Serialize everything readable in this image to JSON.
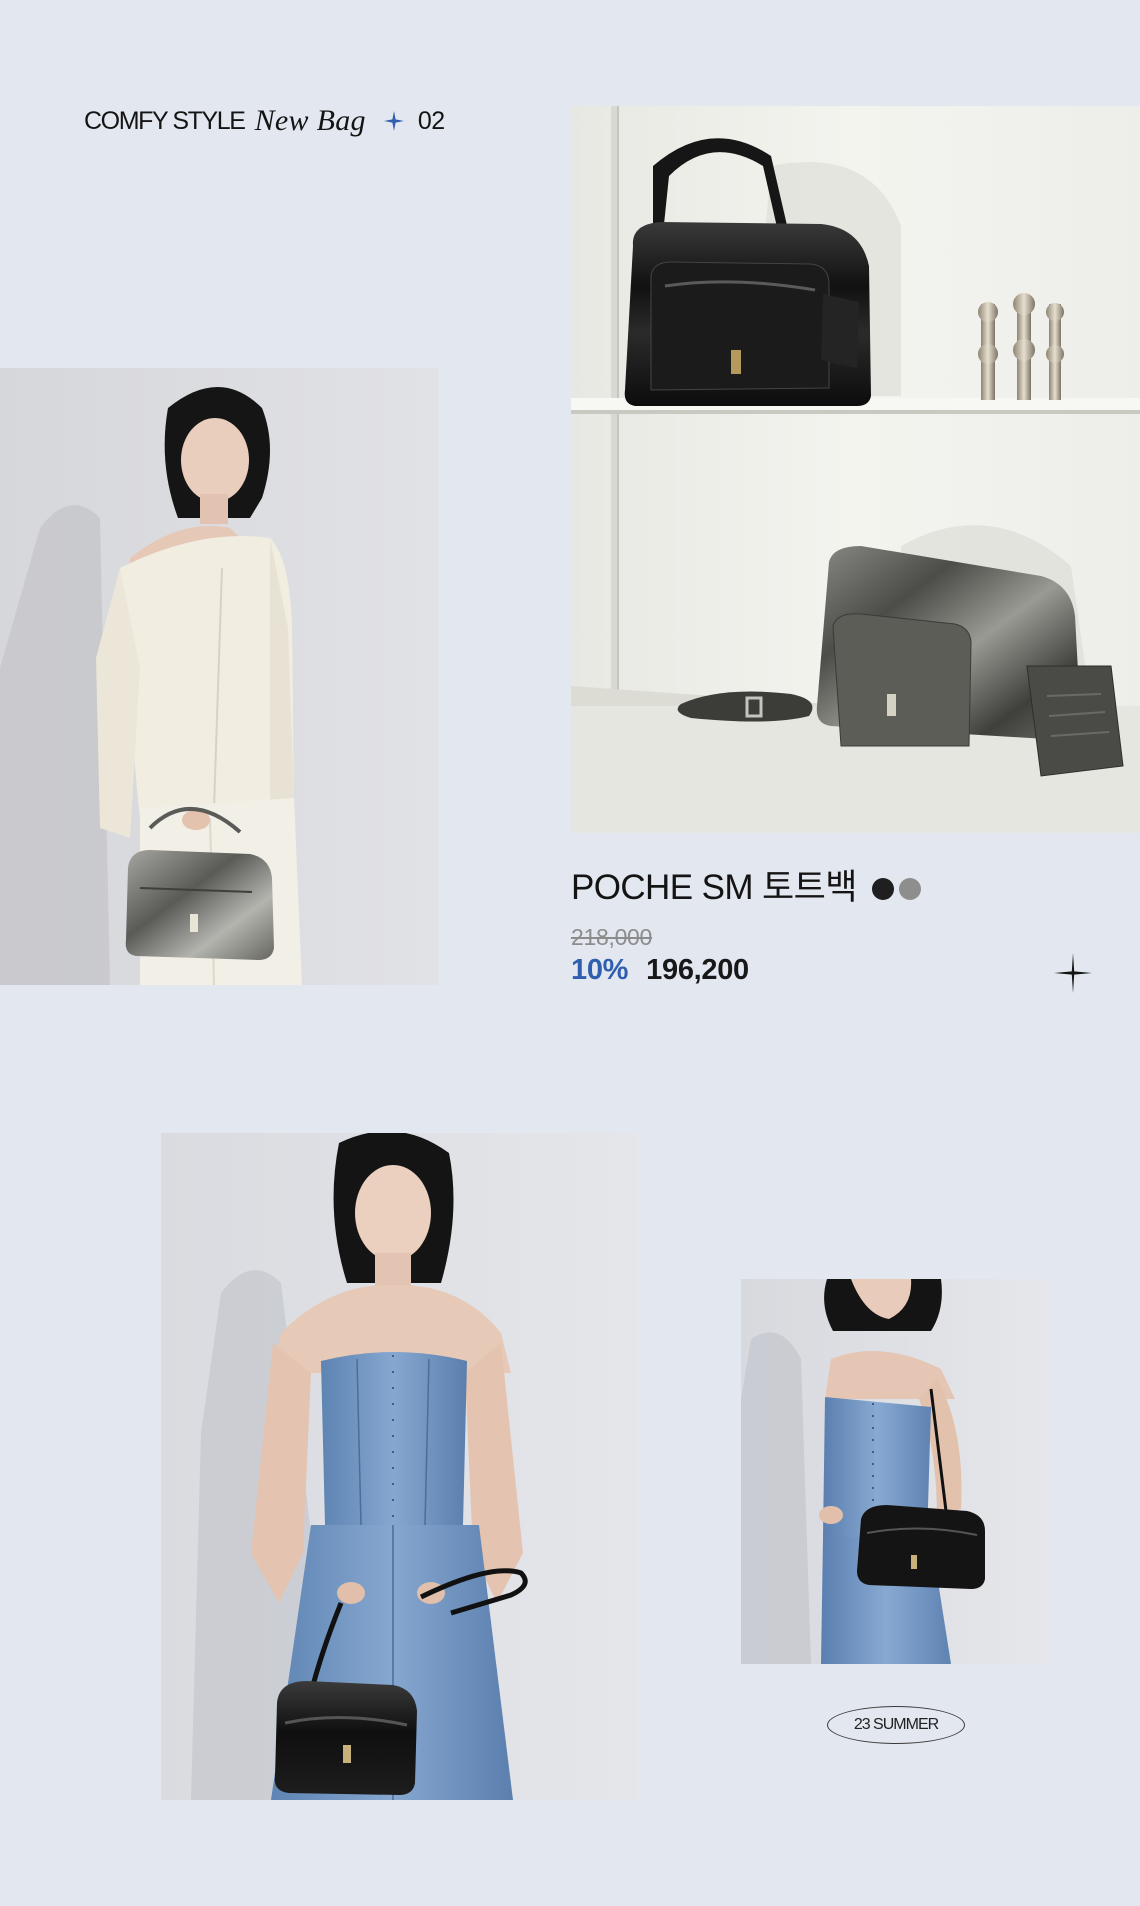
{
  "header": {
    "brand": "COMFY STYLE",
    "script_title": "New Bag",
    "number": "02"
  },
  "product": {
    "name": "POCHE SM 토트백",
    "original_price": "218,000",
    "discount": "10%",
    "sale_price": "196,200",
    "color_options": [
      {
        "name": "black",
        "color": "#1f1f1f"
      },
      {
        "name": "silver",
        "color": "#8e8e8e"
      }
    ]
  },
  "season_label": "23 SUMMER",
  "colors": {
    "background": "#e3e7ef",
    "accent": "#2f5fae",
    "text": "#141414",
    "strike_price": "#8c8c8c"
  },
  "icons": {
    "header_spark": "four-point-star-icon",
    "corner_spark": "four-point-star-icon"
  }
}
